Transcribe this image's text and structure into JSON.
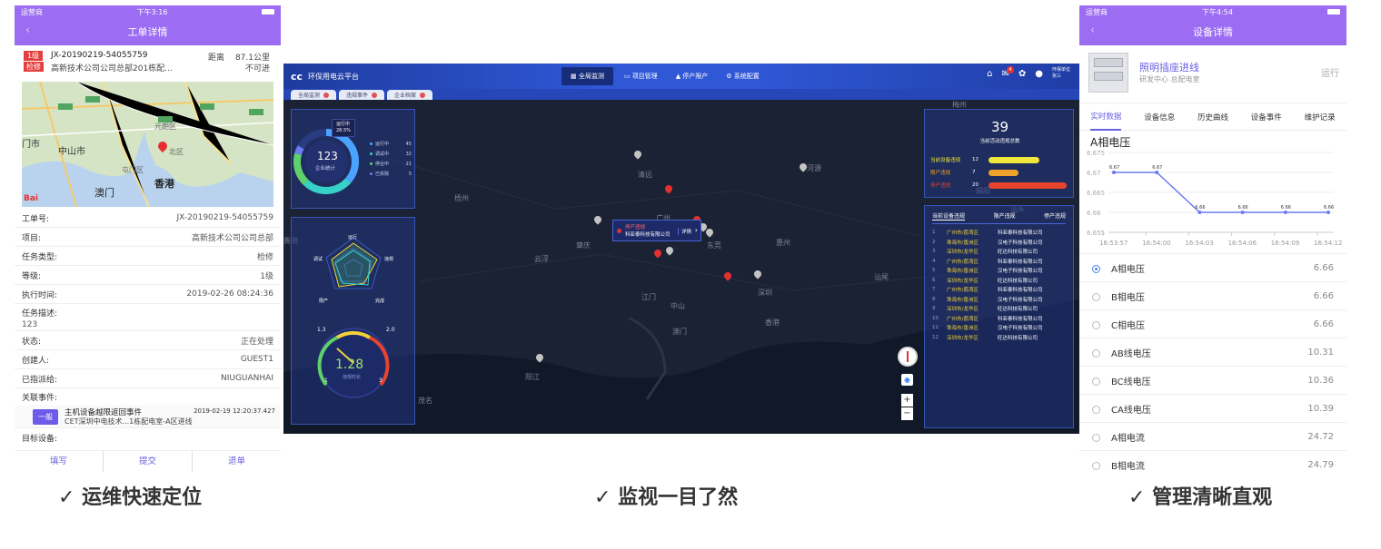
{
  "phone1": {
    "carrier": "运营商",
    "time": "下午3:16",
    "title": "工单详情",
    "level_badge": "1级",
    "type_badge": "检修",
    "order_no": "JX-20190219-54055759",
    "order_addr": "高新技术公司公司总部201栋配...",
    "distance_label": "距离",
    "distance_value": "87.1公里",
    "reachable": "不可进",
    "map_labels": [
      "中山市",
      "门市",
      "香港",
      "澳门",
      "北区",
      "元朗区",
      "屯门区"
    ],
    "fields": [
      {
        "k": "工单号:",
        "v": "JX-20190219-54055759"
      },
      {
        "k": "项目:",
        "v": "高新技术公司公司总部"
      },
      {
        "k": "任务类型:",
        "v": "检修"
      },
      {
        "k": "等级:",
        "v": "1级"
      },
      {
        "k": "执行时间:",
        "v": "2019-02-26 08:24:36"
      },
      {
        "k": "任务描述:",
        "v": ""
      }
    ],
    "desc_value": "123",
    "fields2": [
      {
        "k": "状态:",
        "v": "正在处理"
      },
      {
        "k": "创建人:",
        "v": "GUEST1"
      },
      {
        "k": "已指派给:",
        "v": "NIUGUANHAI"
      },
      {
        "k": "关联事件:",
        "v": ""
      }
    ],
    "event": {
      "badge": "一般",
      "title": "主机设备越限返回事件",
      "time": "2019-02-19 12:20:37.427",
      "sub": "CET深圳中电技术...1栋配电室-A区进线"
    },
    "target_label": "目标设备:",
    "actions": [
      "填写",
      "提交",
      "退单"
    ]
  },
  "dash": {
    "logo": "环保用电云平台",
    "nav": [
      "全局监测",
      "项目管理",
      "停产限产",
      "系统配置"
    ],
    "user_line1": "环保单位",
    "user_line2": "张三",
    "notif_count": "4",
    "tabs": [
      "全局监测",
      "违规事件",
      "企业档案"
    ],
    "donut": {
      "center": "123",
      "sub": "企业统计",
      "tip_label": "运行中",
      "tip_value": "28.5%",
      "legend": [
        {
          "name": "运行中",
          "v": "45",
          "color": "#4aa3ff"
        },
        {
          "name": "调试中",
          "v": "32",
          "color": "#36d2c7"
        },
        {
          "name": "停业中",
          "v": "21",
          "color": "#5fd16a"
        },
        {
          "name": "已拆除",
          "v": "5",
          "color": "#6b7bf0"
        }
      ]
    },
    "radar": {
      "labels": [
        "运行",
        "违规",
        "完成",
        "限产",
        "调试"
      ],
      "bottom_label": "限产"
    },
    "gauge": {
      "value": "1.28",
      "sub": "违规时长",
      "min": "1",
      "max": "3",
      "l1": "1.3",
      "l2": "2.0"
    },
    "summary": {
      "count": "39",
      "label": "当前活动违规总数",
      "bars": [
        {
          "name": "当前设备违规",
          "v": "12",
          "color": "#f0e63c"
        },
        {
          "name": "限产违规",
          "v": "7",
          "color": "#f0a32a"
        },
        {
          "name": "停产违规",
          "v": "20",
          "color": "#e8432c"
        }
      ]
    },
    "list_tabs": [
      "当前设备违规",
      "限产违规",
      "停产违规"
    ],
    "list": [
      {
        "n": "1",
        "a": "广州市/荔湾区",
        "b": "科亚泰科技有限公司"
      },
      {
        "n": "2",
        "a": "珠海市/香洲区",
        "b": "汉电子科技有限公司"
      },
      {
        "n": "3",
        "a": "深圳市/龙华区",
        "b": "旺达科技有限公司"
      },
      {
        "n": "4",
        "a": "广州市/荔湾区",
        "b": "科亚泰科技有限公司"
      },
      {
        "n": "5",
        "a": "珠海市/香洲区",
        "b": "汉电子科技有限公司"
      },
      {
        "n": "6",
        "a": "深圳市/龙华区",
        "b": "旺达科技有限公司"
      },
      {
        "n": "7",
        "a": "广州市/荔湾区",
        "b": "科亚泰科技有限公司"
      },
      {
        "n": "8",
        "a": "珠海市/香洲区",
        "b": "汉电子科技有限公司"
      },
      {
        "n": "9",
        "a": "深圳市/龙华区",
        "b": "旺达科技有限公司"
      },
      {
        "n": "10",
        "a": "广州市/荔湾区",
        "b": "科亚泰科技有限公司"
      },
      {
        "n": "11",
        "a": "珠海市/香洲区",
        "b": "汉电子科技有限公司"
      },
      {
        "n": "12",
        "a": "深圳市/龙华区",
        "b": "旺达科技有限公司"
      }
    ],
    "map_cities": [
      "梅州",
      "清远",
      "河源",
      "广州",
      "惠州",
      "肇庆",
      "云浮",
      "东莞",
      "江门",
      "中山",
      "深圳",
      "香港",
      "澳门",
      "汕尾",
      "阳江",
      "茂名",
      "揭阳",
      "汕头",
      "梧州",
      "贵港"
    ],
    "popup": {
      "title": "停产违规",
      "company": "科亚泰科技有限公司",
      "detail": "详情"
    }
  },
  "phone2": {
    "carrier": "运营商",
    "time": "下午4:54",
    "title": "设备详情",
    "device_name": "照明插座进线",
    "device_loc": "研发中心 总配电室",
    "device_status": "运行",
    "tabs": [
      "实时数据",
      "设备信息",
      "历史曲线",
      "设备事件",
      "维护记录"
    ],
    "chart_title": "A相电压",
    "chart_data": {
      "type": "line",
      "categories": [
        "16:53:57",
        "16:54:00",
        "16:54:03",
        "16:54:06",
        "16:54:09",
        "16:54:12"
      ],
      "values": [
        6.67,
        6.67,
        6.66,
        6.66,
        6.66,
        6.66
      ],
      "ylim": [
        6.655,
        6.675
      ],
      "yticks": [
        "6.675",
        "6.67",
        "6.665",
        "6.66",
        "6.655"
      ],
      "data_labels": [
        "6.67",
        "6.67",
        "6.66",
        "6.66",
        "6.66",
        "6.66"
      ],
      "color": "#6b7cf0"
    },
    "measures": [
      {
        "name": "A相电压",
        "v": "6.66"
      },
      {
        "name": "B相电压",
        "v": "6.66"
      },
      {
        "name": "C相电压",
        "v": "6.66"
      },
      {
        "name": "AB线电压",
        "v": "10.31"
      },
      {
        "name": "BC线电压",
        "v": "10.36"
      },
      {
        "name": "CA线电压",
        "v": "10.39"
      },
      {
        "name": "A相电流",
        "v": "24.72"
      },
      {
        "name": "B相电流",
        "v": "24.79"
      }
    ]
  },
  "captions": [
    "✓ 运维快速定位",
    "✓ 监视一目了然",
    "✓ 管理清晰直观"
  ],
  "colors": {
    "purple": "#9c6cf2",
    "accent_blue": "#2f57d6",
    "badge_red": "#e53e3e"
  }
}
